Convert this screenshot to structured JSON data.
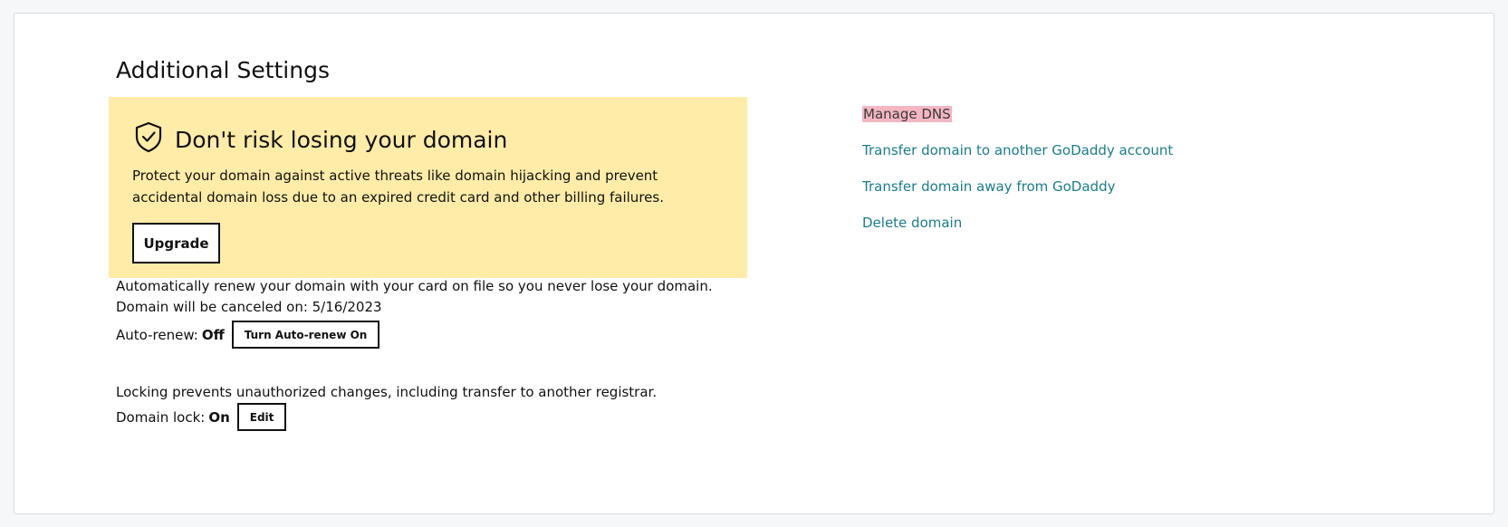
{
  "section": {
    "title": "Additional Settings"
  },
  "promo": {
    "heading": "Don't risk losing your domain",
    "body": "Protect your domain against active threats like domain hijacking and prevent accidental domain loss due to an expired credit card and other billing failures.",
    "button_label": "Upgrade",
    "background_color": "#ffeca8",
    "icon": "shield-check-icon"
  },
  "auto_renew": {
    "description": "Automatically renew your domain with your card on file so you never lose your domain.",
    "cancel_text": "Domain will be canceled on: 5/16/2023",
    "label": "Auto-renew:",
    "status": "Off",
    "button_label": "Turn Auto-renew On"
  },
  "domain_lock": {
    "description": "Locking prevents unauthorized changes, including transfer to another registrar.",
    "label": "Domain lock:",
    "status": "On",
    "button_label": "Edit"
  },
  "links": [
    {
      "label": "Manage DNS",
      "highlighted": true
    },
    {
      "label": "Transfer domain to another GoDaddy account",
      "highlighted": false
    },
    {
      "label": "Transfer domain away from GoDaddy",
      "highlighted": false
    },
    {
      "label": "Delete domain",
      "highlighted": false
    }
  ],
  "colors": {
    "link": "#1b7c8c",
    "highlight": "#f4b6c2"
  }
}
